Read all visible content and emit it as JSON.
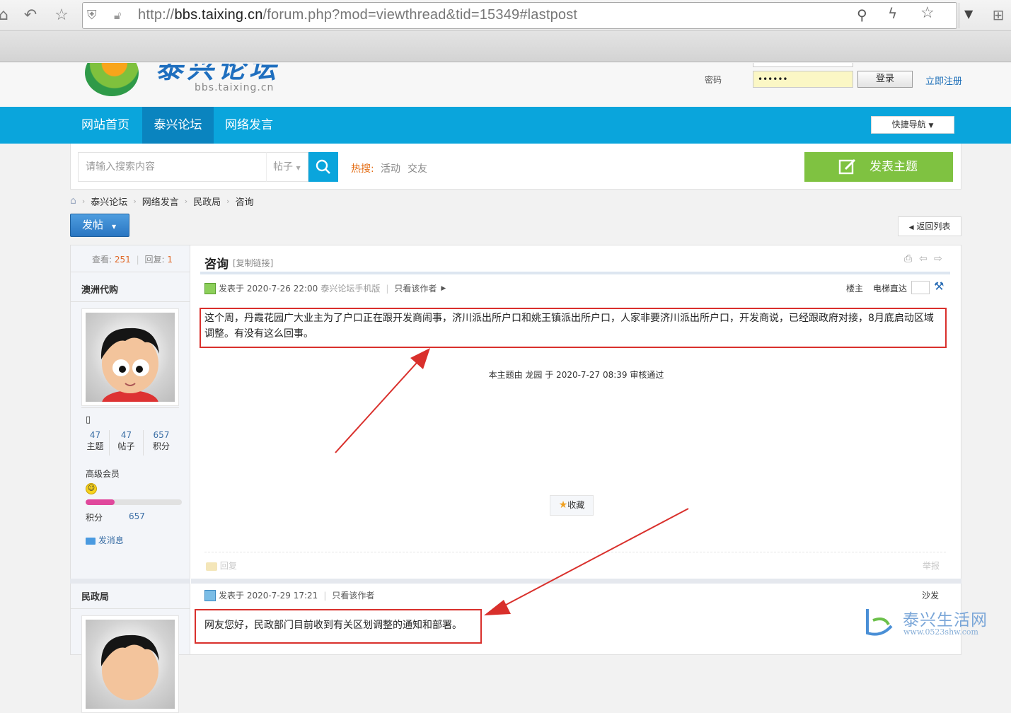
{
  "browser": {
    "url_prefix": "http://",
    "url_domain": "bbs.taixing.cn",
    "url_path": "/forum.php?mod=viewthread&tid=15349#lastpost"
  },
  "header": {
    "logo_text": "泰兴论坛",
    "logo_sub": "bbs.taixing.cn",
    "password_label": "密码",
    "password_value": "••••••",
    "login_label": "登录",
    "register_label": "立即注册"
  },
  "nav": {
    "items": [
      {
        "label": "网站首页"
      },
      {
        "label": "泰兴论坛"
      },
      {
        "label": "网络发言"
      }
    ],
    "quick_nav": "快捷导航"
  },
  "search": {
    "placeholder": "请输入搜索内容",
    "type": "帖子",
    "hot_label": "热搜:",
    "hot_words": [
      "活动",
      "交友"
    ],
    "post_topic": "发表主题"
  },
  "breadcrumb": [
    "泰兴论坛",
    "网络发言",
    "民政局",
    "咨询"
  ],
  "toolbar": {
    "post_button": "发帖",
    "back_to_list": "返回列表"
  },
  "thread": {
    "views_label": "查看:",
    "views": "251",
    "replies_label": "回复:",
    "replies": "1",
    "title": "咨询",
    "copy_link": "[复制链接]"
  },
  "post1": {
    "author": "澳洲代购",
    "stats": [
      {
        "num": "47",
        "label": "主题"
      },
      {
        "num": "47",
        "label": "帖子"
      },
      {
        "num": "657",
        "label": "积分"
      }
    ],
    "rank": "高级会员",
    "level_progress": 0.3,
    "points_label": "积分",
    "points": "657",
    "send_msg": "发消息",
    "meta_posted": "发表于 2020-7-26 22:00",
    "meta_source": "泰兴论坛手机版",
    "meta_only_author": "只看该作者",
    "floor": "楼主",
    "elevator": "电梯直达",
    "content": "这个周，丹霞花园广大业主为了户口正在跟开发商闹事，济川派出所户口和姚王镇派出所户口，人家非要济川派出所户口，开发商说，已经跟政府对接，8月底启动区域调整。有没有这么回事。",
    "review_note": "本主题由 龙园 于 2020-7-27 08:39 审核通过",
    "favorite": "收藏",
    "reply": "回复",
    "report": "举报"
  },
  "post2": {
    "author": "民政局",
    "meta_posted": "发表于 2020-7-29 17:21",
    "meta_only_author": "只看该作者",
    "floor": "沙发",
    "content": "网友您好，民政部门目前收到有关区划调整的通知和部署。"
  },
  "watermark": {
    "name": "泰兴生活网",
    "url": "www.0523shw.com"
  },
  "colors": {
    "nav_blue": "#0aa5dc",
    "nav_active": "#0a84bf",
    "green_button": "#7fc241",
    "annotation_red": "#d9302c"
  }
}
